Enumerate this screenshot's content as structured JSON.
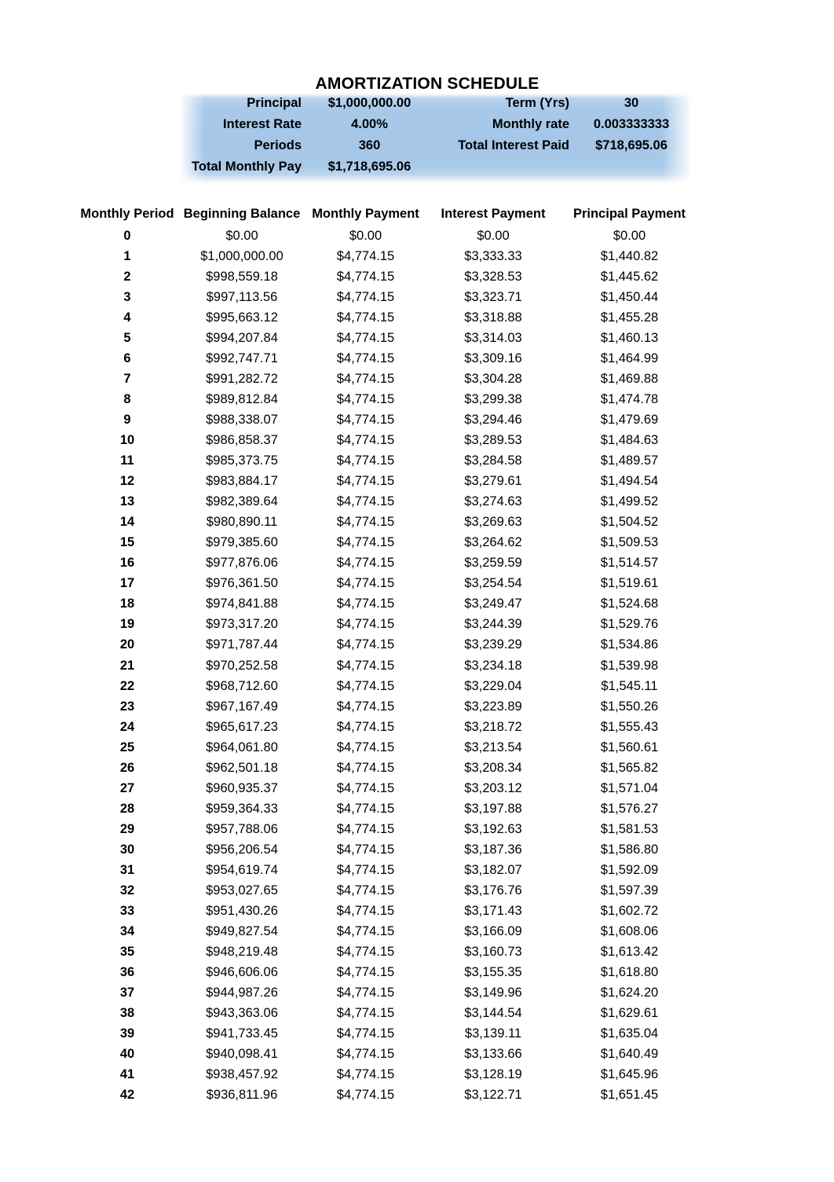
{
  "document": {
    "title": "AMORTIZATION SCHEDULE"
  },
  "theme": {
    "banner_blue": "#a8c8e8",
    "banner_blue_light": "#c3daf0",
    "text_color": "#000000",
    "page_background": "#ffffff"
  },
  "summary": {
    "rows": [
      {
        "label_left": "Principal",
        "value_left": "$1,000,000.00",
        "label_right": "Term (Yrs)",
        "value_right": "30"
      },
      {
        "label_left": "Interest Rate",
        "value_left": "4.00%",
        "label_right": "Monthly rate",
        "value_right": "0.003333333"
      },
      {
        "label_left": "Periods",
        "value_left": "360",
        "label_right": "Total Interest Paid",
        "value_right": "$718,695.06"
      },
      {
        "label_left": "Total Monthly Pay",
        "value_left": "$1,718,695.06",
        "label_right": "",
        "value_right": ""
      }
    ]
  },
  "schedule": {
    "columns": [
      "Monthly Period",
      "Beginning Balance",
      "Monthly Payment",
      "Interest Payment",
      "Principal Payment"
    ],
    "rows": [
      [
        "0",
        "$0.00",
        "$0.00",
        "$0.00",
        "$0.00"
      ],
      [
        "1",
        "$1,000,000.00",
        "$4,774.15",
        "$3,333.33",
        "$1,440.82"
      ],
      [
        "2",
        "$998,559.18",
        "$4,774.15",
        "$3,328.53",
        "$1,445.62"
      ],
      [
        "3",
        "$997,113.56",
        "$4,774.15",
        "$3,323.71",
        "$1,450.44"
      ],
      [
        "4",
        "$995,663.12",
        "$4,774.15",
        "$3,318.88",
        "$1,455.28"
      ],
      [
        "5",
        "$994,207.84",
        "$4,774.15",
        "$3,314.03",
        "$1,460.13"
      ],
      [
        "6",
        "$992,747.71",
        "$4,774.15",
        "$3,309.16",
        "$1,464.99"
      ],
      [
        "7",
        "$991,282.72",
        "$4,774.15",
        "$3,304.28",
        "$1,469.88"
      ],
      [
        "8",
        "$989,812.84",
        "$4,774.15",
        "$3,299.38",
        "$1,474.78"
      ],
      [
        "9",
        "$988,338.07",
        "$4,774.15",
        "$3,294.46",
        "$1,479.69"
      ],
      [
        "10",
        "$986,858.37",
        "$4,774.15",
        "$3,289.53",
        "$1,484.63"
      ],
      [
        "11",
        "$985,373.75",
        "$4,774.15",
        "$3,284.58",
        "$1,489.57"
      ],
      [
        "12",
        "$983,884.17",
        "$4,774.15",
        "$3,279.61",
        "$1,494.54"
      ],
      [
        "13",
        "$982,389.64",
        "$4,774.15",
        "$3,274.63",
        "$1,499.52"
      ],
      [
        "14",
        "$980,890.11",
        "$4,774.15",
        "$3,269.63",
        "$1,504.52"
      ],
      [
        "15",
        "$979,385.60",
        "$4,774.15",
        "$3,264.62",
        "$1,509.53"
      ],
      [
        "16",
        "$977,876.06",
        "$4,774.15",
        "$3,259.59",
        "$1,514.57"
      ],
      [
        "17",
        "$976,361.50",
        "$4,774.15",
        "$3,254.54",
        "$1,519.61"
      ],
      [
        "18",
        "$974,841.88",
        "$4,774.15",
        "$3,249.47",
        "$1,524.68"
      ],
      [
        "19",
        "$973,317.20",
        "$4,774.15",
        "$3,244.39",
        "$1,529.76"
      ],
      [
        "20",
        "$971,787.44",
        "$4,774.15",
        "$3,239.29",
        "$1,534.86"
      ],
      [
        "21",
        "$970,252.58",
        "$4,774.15",
        "$3,234.18",
        "$1,539.98"
      ],
      [
        "22",
        "$968,712.60",
        "$4,774.15",
        "$3,229.04",
        "$1,545.11"
      ],
      [
        "23",
        "$967,167.49",
        "$4,774.15",
        "$3,223.89",
        "$1,550.26"
      ],
      [
        "24",
        "$965,617.23",
        "$4,774.15",
        "$3,218.72",
        "$1,555.43"
      ],
      [
        "25",
        "$964,061.80",
        "$4,774.15",
        "$3,213.54",
        "$1,560.61"
      ],
      [
        "26",
        "$962,501.18",
        "$4,774.15",
        "$3,208.34",
        "$1,565.82"
      ],
      [
        "27",
        "$960,935.37",
        "$4,774.15",
        "$3,203.12",
        "$1,571.04"
      ],
      [
        "28",
        "$959,364.33",
        "$4,774.15",
        "$3,197.88",
        "$1,576.27"
      ],
      [
        "29",
        "$957,788.06",
        "$4,774.15",
        "$3,192.63",
        "$1,581.53"
      ],
      [
        "30",
        "$956,206.54",
        "$4,774.15",
        "$3,187.36",
        "$1,586.80"
      ],
      [
        "31",
        "$954,619.74",
        "$4,774.15",
        "$3,182.07",
        "$1,592.09"
      ],
      [
        "32",
        "$953,027.65",
        "$4,774.15",
        "$3,176.76",
        "$1,597.39"
      ],
      [
        "33",
        "$951,430.26",
        "$4,774.15",
        "$3,171.43",
        "$1,602.72"
      ],
      [
        "34",
        "$949,827.54",
        "$4,774.15",
        "$3,166.09",
        "$1,608.06"
      ],
      [
        "35",
        "$948,219.48",
        "$4,774.15",
        "$3,160.73",
        "$1,613.42"
      ],
      [
        "36",
        "$946,606.06",
        "$4,774.15",
        "$3,155.35",
        "$1,618.80"
      ],
      [
        "37",
        "$944,987.26",
        "$4,774.15",
        "$3,149.96",
        "$1,624.20"
      ],
      [
        "38",
        "$943,363.06",
        "$4,774.15",
        "$3,144.54",
        "$1,629.61"
      ],
      [
        "39",
        "$941,733.45",
        "$4,774.15",
        "$3,139.11",
        "$1,635.04"
      ],
      [
        "40",
        "$940,098.41",
        "$4,774.15",
        "$3,133.66",
        "$1,640.49"
      ],
      [
        "41",
        "$938,457.92",
        "$4,774.15",
        "$3,128.19",
        "$1,645.96"
      ],
      [
        "42",
        "$936,811.96",
        "$4,774.15",
        "$3,122.71",
        "$1,651.45"
      ]
    ]
  }
}
